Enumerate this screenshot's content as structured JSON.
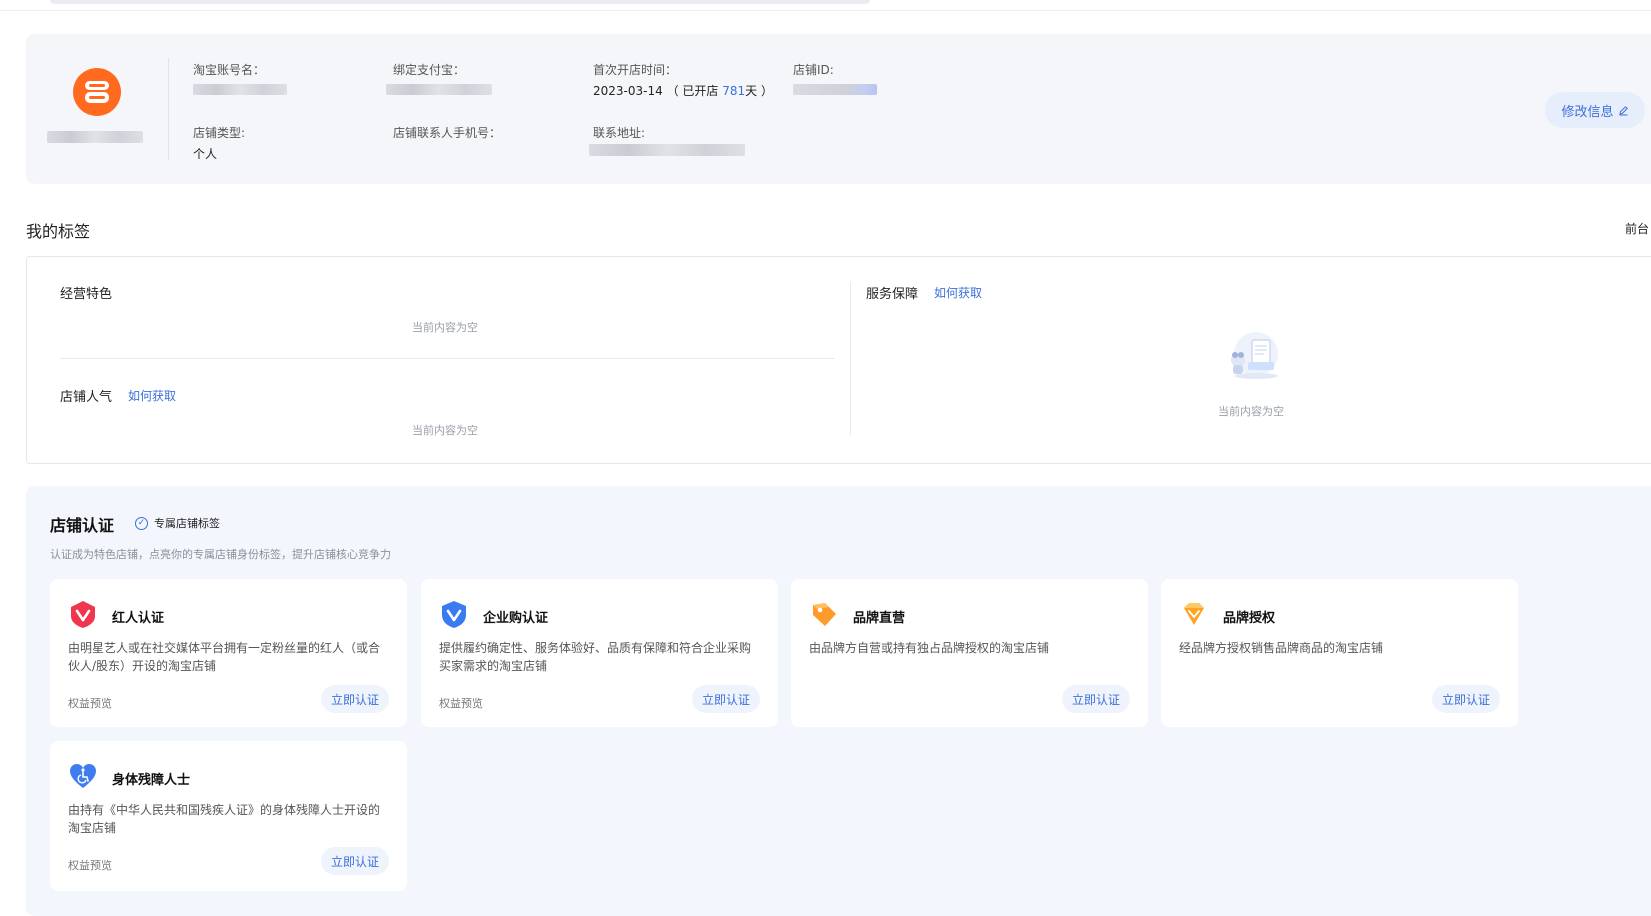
{
  "store_info": {
    "taobao_account_label": "淘宝账号名：",
    "alipay_label": "绑定支付宝：",
    "first_open_label": "首次开店时间：",
    "first_open_date": "2023-03-14",
    "open_prefix": "（ 已开店 ",
    "open_days": "781",
    "open_suffix": "天 ）",
    "store_id_label": "店铺ID:",
    "store_type_label": "店铺类型:",
    "store_type_value": "个人",
    "contact_phone_label": "店铺联系人手机号：",
    "address_label": "联系地址:",
    "edit_button": "修改信息"
  },
  "my_tags": {
    "title": "我的标签",
    "right_link": "前台",
    "business_features": {
      "title": "经营特色",
      "empty_text": "当前内容为空"
    },
    "store_popularity": {
      "title": "店铺人气",
      "how_link": "如何获取",
      "empty_text": "当前内容为空"
    },
    "service_guarantee": {
      "title": "服务保障",
      "how_link": "如何获取",
      "empty_text": "当前内容为空"
    }
  },
  "certification": {
    "title": "店铺认证",
    "exclusive_badge": "专属店铺标签",
    "subtitle": "认证成为特色店铺，点亮你的专属店铺身份标签，提升店铺核心竞争力",
    "cards": [
      {
        "name": "红人认证",
        "icon": "red-v-shield-icon",
        "description": "由明星艺人或在社交媒体平台拥有一定粉丝量的红人（或合伙人/股东）开设的淘宝店铺",
        "preview": "权益预览",
        "button": "立即认证"
      },
      {
        "name": "企业购认证",
        "icon": "blue-v-shield-icon",
        "description": "提供履约确定性、服务体验好、品质有保障和符合企业采购买家需求的淘宝店铺",
        "preview": "权益预览",
        "button": "立即认证"
      },
      {
        "name": "品牌直营",
        "icon": "orange-tag-icon",
        "description": "由品牌方自营或持有独占品牌授权的淘宝店铺",
        "preview": "",
        "button": "立即认证"
      },
      {
        "name": "品牌授权",
        "icon": "orange-diamond-icon",
        "description": "经品牌方授权销售品牌商品的淘宝店铺",
        "preview": "",
        "button": "立即认证"
      },
      {
        "name": "身体残障人士",
        "icon": "blue-heart-accessibility-icon",
        "description": "由持有《中华人民共和国残疾人证》的身体残障人士开设的淘宝店铺",
        "preview": "权益预览",
        "button": "立即认证"
      }
    ]
  },
  "colors": {
    "accent_blue": "#3d6fd9",
    "logo_orange": "#ff6a1f",
    "panel_bg": "#f4f6f9",
    "cert_bg": "#f3f6fd"
  }
}
